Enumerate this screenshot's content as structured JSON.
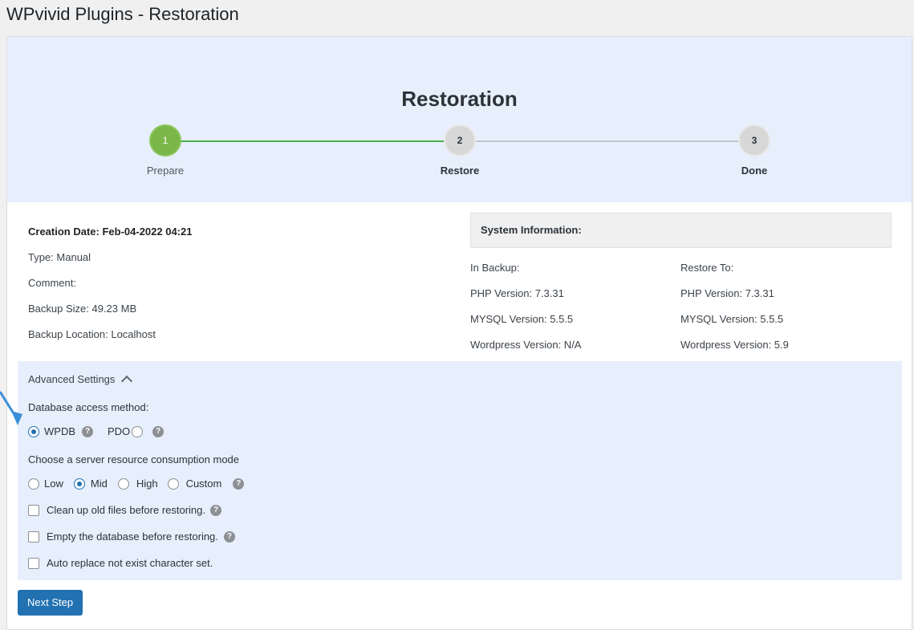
{
  "page": {
    "title": "WPvivid Plugins - Restoration"
  },
  "stepper": {
    "title": "Restoration",
    "steps": [
      {
        "number": "1",
        "label": "Prepare"
      },
      {
        "number": "2",
        "label": "Restore"
      },
      {
        "number": "3",
        "label": "Done"
      }
    ],
    "colors": {
      "active": "#7ab648",
      "line_done": "#4cae4f",
      "pending": "#d7d7d7"
    }
  },
  "backup_info": {
    "creation_date": "Creation Date: Feb-04-2022 04:21",
    "type": "Type: Manual",
    "comment": "Comment:",
    "size": "Backup Size: 49.23 MB",
    "location": "Backup Location: Localhost"
  },
  "system_info": {
    "header": "System Information:",
    "in_backup": {
      "heading": "In Backup:",
      "php": "PHP Version: 7.3.31",
      "mysql": "MYSQL Version: 5.5.5",
      "wordpress": "Wordpress Version: N/A"
    },
    "restore_to": {
      "heading": "Restore To:",
      "php": "PHP Version: 7.3.31",
      "mysql": "MYSQL Version: 5.5.5",
      "wordpress": "Wordpress Version: 5.9"
    }
  },
  "advanced": {
    "toggle_label": "Advanced Settings",
    "db_method_label": "Database access method:",
    "db_methods": [
      {
        "label": "WPDB",
        "checked": true
      },
      {
        "label": "PDO",
        "checked": false
      }
    ],
    "resource_label": "Choose a server resource consumption mode",
    "resource_modes": [
      {
        "label": "Low",
        "checked": false
      },
      {
        "label": "Mid",
        "checked": true
      },
      {
        "label": "High",
        "checked": false
      },
      {
        "label": "Custom",
        "checked": false
      }
    ],
    "options": {
      "cleanup": "Clean up old files before restoring.",
      "empty_db": "Empty the database before restoring.",
      "auto_replace": "Auto replace not exist character set."
    },
    "help_glyph": "?"
  },
  "actions": {
    "next_step": "Next Step"
  },
  "colors": {
    "accent": "#2271b1",
    "panel_bg": "#e7effd",
    "annotation_arrow": "#3b8fd9"
  }
}
